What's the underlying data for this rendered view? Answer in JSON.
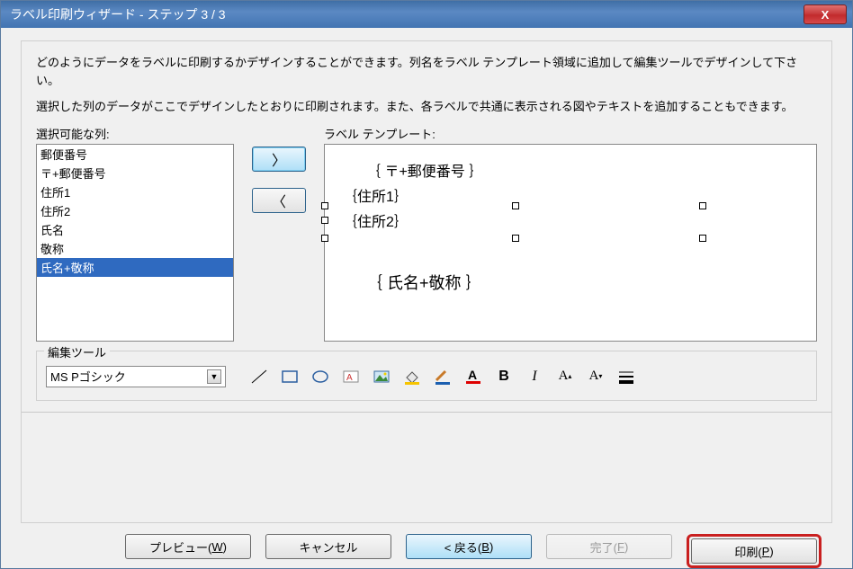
{
  "titlebar": {
    "title": "ラベル印刷ウィザード - ステップ 3 / 3",
    "close": "X"
  },
  "desc1": "どのようにデータをラベルに印刷するかデザインすることができます。列名をラベル テンプレート領域に追加して編集ツールでデザインして下さい。",
  "desc2": "選択した列のデータがここでデザインしたとおりに印刷されます。また、各ラベルで共通に表示される図やテキストを追加することもできます。",
  "left_label": "選択可能な列:",
  "right_label": "ラベル テンプレート:",
  "columns": {
    "items": [
      "郵便番号",
      "〒+郵便番号",
      "住所1",
      "住所2",
      "氏名",
      "敬称",
      "氏名+敬称"
    ],
    "selected_index": 6
  },
  "arrows": {
    "add": "〉",
    "remove": "〈"
  },
  "template": {
    "lines": [
      "｛ 〒+郵便番号 ｝",
      "｛住所1｝",
      "｛住所2｝",
      "",
      "｛ 氏名+敬称 ｝"
    ]
  },
  "tools": {
    "legend": "編集ツール",
    "font": "MS Pゴシック",
    "bold": "B",
    "italic": "I",
    "fontA": "A",
    "bigA": "A",
    "smallA": "A"
  },
  "buttons": {
    "preview": "プレビュー(",
    "preview_u": "W",
    "preview_end": ")",
    "cancel": "キャンセル",
    "back": "< 戻る(",
    "back_u": "B",
    "back_end": ")",
    "finish": "完了(",
    "finish_u": "F",
    "finish_end": ")",
    "print": "印刷(",
    "print_u": "P",
    "print_end": ")"
  }
}
